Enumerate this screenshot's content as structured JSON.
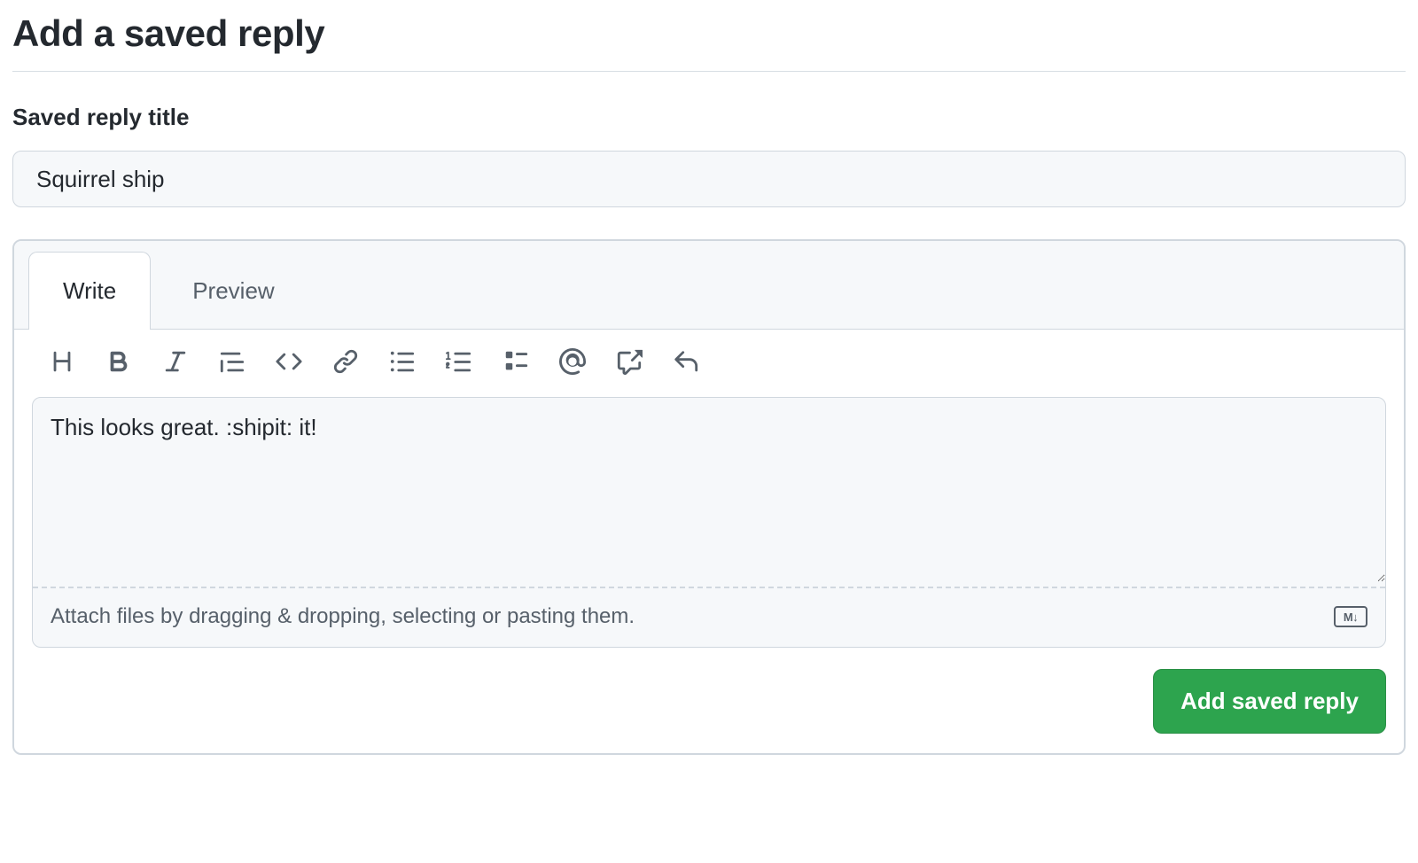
{
  "heading": "Add a saved reply",
  "title_field": {
    "label": "Saved reply title",
    "value": "Squirrel ship",
    "placeholder": ""
  },
  "editor": {
    "tabs": {
      "write": "Write",
      "preview": "Preview",
      "active": "write"
    },
    "body_value": "This looks great. :shipit: it!",
    "attach_hint": "Attach files by dragging & dropping, selecting or pasting them.",
    "markdown_badge": "M↓"
  },
  "toolbar_icons": [
    "heading",
    "bold",
    "italic",
    "quote",
    "code",
    "link",
    "unordered-list",
    "ordered-list",
    "task-list",
    "mention",
    "cross-reference",
    "reply"
  ],
  "actions": {
    "submit_label": "Add saved reply"
  },
  "colors": {
    "fg": "#24292f",
    "fg_muted": "#57606a",
    "border": "#d0d7de",
    "bg_subtle": "#f6f8fa",
    "accent": "#2da44e"
  }
}
